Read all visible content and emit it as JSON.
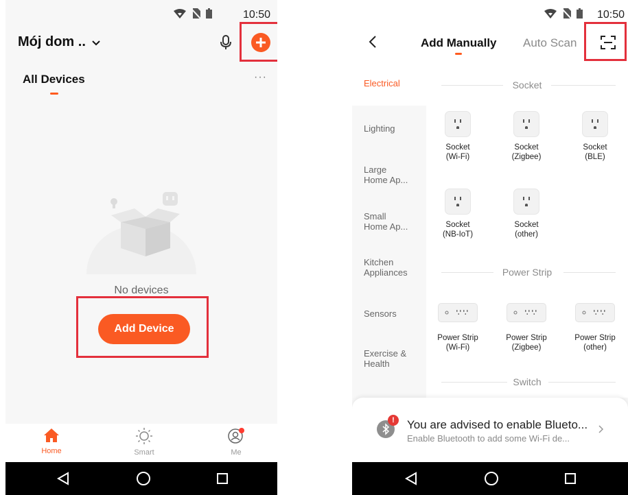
{
  "left": {
    "status": {
      "time": "10:50"
    },
    "header": {
      "home_name": "Mój dom ..",
      "chevron_icon": "chevron-down-icon",
      "mic_icon": "microphone-icon",
      "add_icon": "plus-circle-icon"
    },
    "tabs": {
      "active_label": "All Devices",
      "more_icon": "more-dots-icon"
    },
    "empty_state": {
      "message": "No devices",
      "add_button_label": "Add Device"
    },
    "bottom_tabs": [
      {
        "label": "Home",
        "icon": "home-icon"
      },
      {
        "label": "Smart",
        "icon": "sun-icon"
      },
      {
        "label": "Me",
        "icon": "user-icon"
      }
    ]
  },
  "right": {
    "status": {
      "time": "10:50"
    },
    "header": {
      "back_icon": "chevron-left-icon",
      "tab_manual": "Add Manually",
      "tab_scan": "Auto Scan",
      "scan_icon": "scan-icon"
    },
    "categories": [
      "Electrical",
      "Lighting",
      "Large\nHome Ap...",
      "Small\nHome Ap...",
      "Kitchen\nAppliances",
      "Sensors",
      "Exercise &\nHealth"
    ],
    "sections": {
      "socket_title": "Socket",
      "socket_devices": [
        "Socket\n(Wi-Fi)",
        "Socket\n(Zigbee)",
        "Socket\n(BLE)",
        "Socket\n(NB-IoT)",
        "Socket\n(other)"
      ],
      "strip_title": "Power Strip",
      "strip_devices": [
        "Power Strip\n(Wi-Fi)",
        "Power Strip\n(Zigbee)",
        "Power Strip\n(other)"
      ],
      "switch_title": "Switch"
    },
    "banner": {
      "title": "You are advised to enable Blueto...",
      "subtitle": "Enable Bluetooth to add some Wi-Fi de...",
      "icon": "bluetooth-icon",
      "arrow_icon": "chevron-right-icon"
    }
  },
  "colors": {
    "accent": "#fa5a23",
    "highlight": "#e3303c",
    "nav_bar": "#000000"
  }
}
